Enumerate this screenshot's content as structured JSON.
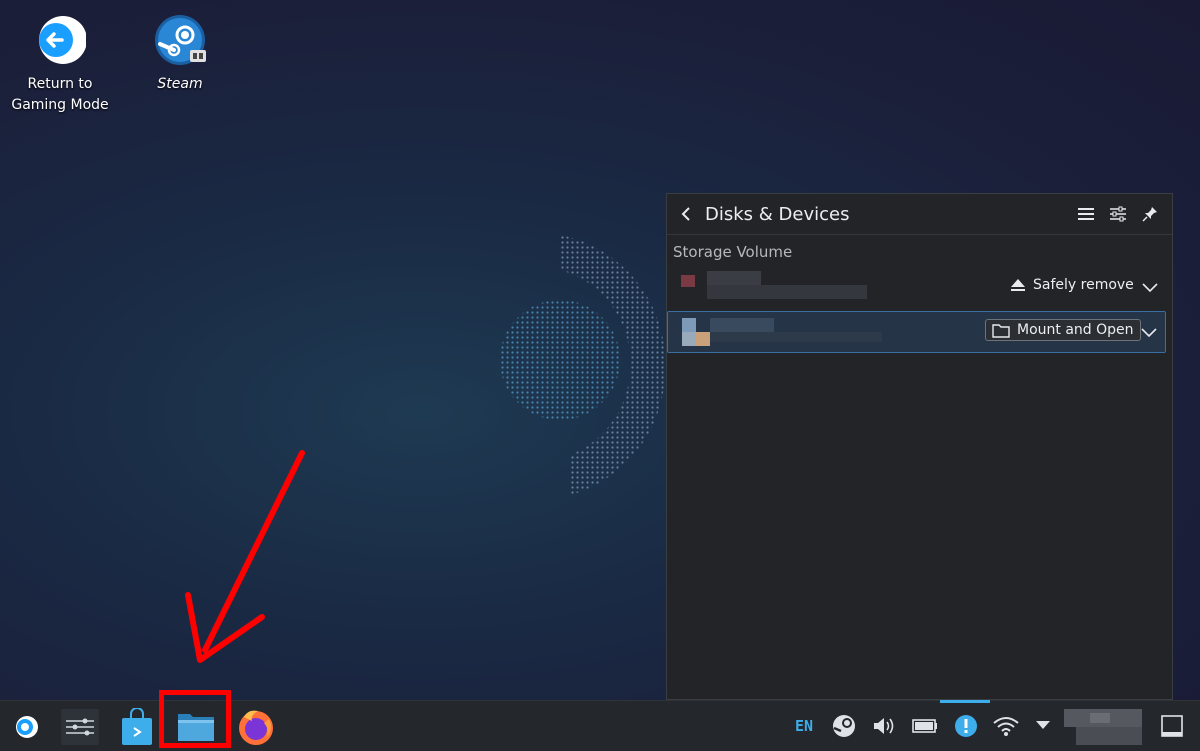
{
  "desktop": {
    "icons": [
      {
        "label": "Return to\nGaming Mode",
        "icon": "return-arrow-icon"
      },
      {
        "label": "Steam",
        "icon": "steam-icon"
      }
    ]
  },
  "panel": {
    "title": "Disks & Devices",
    "section": "Storage Volume",
    "devices": [
      {
        "action": "Safely remove",
        "action_icon": "eject-icon"
      },
      {
        "action": "Mount and Open",
        "action_icon": "folder-icon"
      }
    ]
  },
  "taskbar": {
    "language": "EN",
    "items": [
      "steam-launcher-icon",
      "system-settings-icon",
      "discover-store-icon",
      "file-manager-icon",
      "firefox-icon"
    ],
    "tray": [
      "language-indicator",
      "steam-tray-icon",
      "volume-icon",
      "battery-icon",
      "notifications-icon",
      "wifi-icon",
      "tray-expand-icon",
      "clock",
      "show-desktop-icon"
    ]
  },
  "colors": {
    "accent": "#3daee9",
    "highlight_annotation": "#ff0000",
    "panel_bg": "#222427",
    "taskbar_bg": "#24272b"
  }
}
